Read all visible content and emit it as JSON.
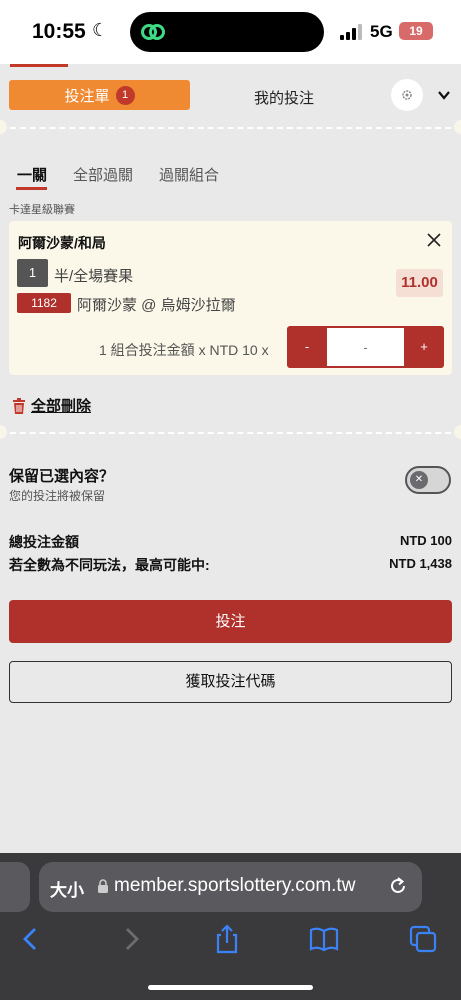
{
  "status_bar": {
    "time": "10:55",
    "network": "5G",
    "battery": "19"
  },
  "header": {
    "tabs": [
      {
        "label": "投注單",
        "badge": "1",
        "active": true
      },
      {
        "label": "我的投注",
        "active": false
      }
    ]
  },
  "subtabs": [
    {
      "label": "一關",
      "active": true
    },
    {
      "label": "全部過關",
      "active": false
    },
    {
      "label": "過關組合",
      "active": false
    }
  ],
  "league": "卡達星級聯賽",
  "bet": {
    "selection": "阿爾沙蒙/和局",
    "period_number": "1",
    "market": "半/全場賽果",
    "odds": "11.00",
    "event_code": "1182",
    "match": "阿爾沙蒙 @ 烏姆沙拉爾",
    "stake_text": "1 組合投注金額 x NTD 10 x",
    "stepper": {
      "minus": "-",
      "placeholder": "-",
      "plus": "+"
    }
  },
  "delete_all": "全部刪除",
  "keep": {
    "title": "保留已選內容？",
    "subtitle": "您的投注將被保留"
  },
  "totals": {
    "total_label": "總投注金額",
    "total_value": "NTD 100",
    "max_label": "若全數為不同玩法，最高可能中:",
    "max_value": "NTD 1,438"
  },
  "buttons": {
    "bet": "投注",
    "get_code": "獲取投注代碼"
  },
  "browser": {
    "text_size": "大小",
    "url": "member.sportslottery.com.tw"
  },
  "colors": {
    "primary_red": "#b0302b",
    "orange": "#ef8a33",
    "card_bg": "#fbf8ea"
  }
}
